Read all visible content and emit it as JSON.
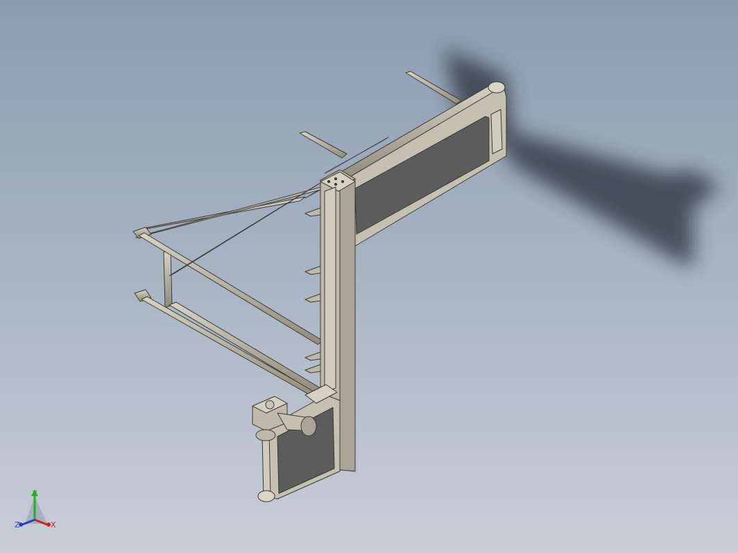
{
  "viewport": {
    "background_top": "#8c9cb0",
    "background_bottom": "#c9ced8",
    "model_color": "#b3b09f",
    "panel_color": "#5c5c5c",
    "shadow_color": "#2e3440"
  },
  "triad": {
    "x_label": "X",
    "y_label": "Y",
    "z_label": "Z",
    "x_color": "#d02020",
    "y_color": "#20b020",
    "z_color": "#2040d0"
  }
}
